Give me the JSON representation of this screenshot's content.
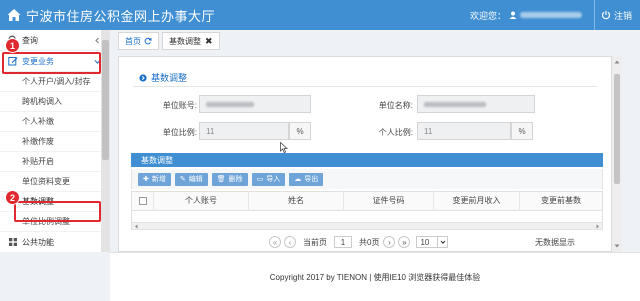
{
  "header": {
    "title": "宁波市住房公积金网上办事大厅",
    "welcome": "欢迎您：",
    "logout": "注销"
  },
  "sidebar": {
    "items": [
      {
        "label": "查询",
        "icon": "search-icon"
      },
      {
        "label": "变更业务",
        "icon": "edit-icon"
      }
    ],
    "sub_items": [
      "个人开户/调入/封存",
      "跨机构调入",
      "个人补缴",
      "补缴作废",
      "补贴开启",
      "单位资料变更",
      "基数调整",
      "单位比例调整"
    ],
    "bottom_item": "公共功能"
  },
  "annotations": {
    "badge_1": "1",
    "badge_2": "2"
  },
  "tabs": {
    "home": "首页",
    "active": "基数调整"
  },
  "panel": {
    "title": "基数调整",
    "unit_account_label": "单位账号:",
    "unit_name_label": "单位名称:",
    "unit_ratio_label": "单位比例:",
    "unit_ratio_value": "11",
    "personal_ratio_label": "个人比例:",
    "personal_ratio_value": "11",
    "percent": "%"
  },
  "grid": {
    "section_title": "基数调整",
    "toolbar": {
      "add": "新增",
      "edit": "编辑",
      "delete": "删除",
      "import": "导入",
      "export": "导出"
    },
    "columns": [
      "个人账号",
      "姓名",
      "证件号码",
      "变更前月收入",
      "变更前基数"
    ]
  },
  "pager": {
    "current_label": "当前页",
    "page": "1",
    "total": "共0页",
    "page_size": "10",
    "no_data": "无数据显示"
  },
  "footer": {
    "text": "Copyright 2017 by TIENON | 使用IE10 浏览器获得最佳体验"
  }
}
